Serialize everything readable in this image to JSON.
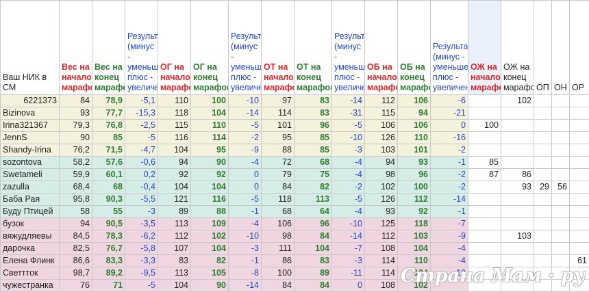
{
  "headers": [
    {
      "text": "Ваш НИК в СМ",
      "style": ""
    },
    {
      "text": "Вес на начало марафона",
      "style": "red"
    },
    {
      "text": "Вес на конец марафона",
      "style": "green"
    },
    {
      "text": "Результат (минус - уменьшение, плюс - увеличение)",
      "style": "blue"
    },
    {
      "text": "ОГ на начало марафона",
      "style": "red"
    },
    {
      "text": "ОГ на конец марафона",
      "style": "green"
    },
    {
      "text": "Результат (минус - уменьшение, плюс - увеличение)",
      "style": "blue"
    },
    {
      "text": "ОТ на начало марафона",
      "style": "red"
    },
    {
      "text": "ОТ на конец марафона",
      "style": "green"
    },
    {
      "text": "Результат (минус - уменьшение, плюс - увеличение)",
      "style": "blue"
    },
    {
      "text": "ОБ на начало марафона",
      "style": "red"
    },
    {
      "text": "ОБ на конец марафона",
      "style": "green"
    },
    {
      "text": "Результат (минус - уменьшение, плюс - увеличение)",
      "style": "blue"
    },
    {
      "text": "ОЖ на начало марафона",
      "style": "sel-red"
    },
    {
      "text": "ОЖ на конец марафона",
      "style": ""
    },
    {
      "text": "ОП",
      "style": ""
    },
    {
      "text": "ОН",
      "style": ""
    },
    {
      "text": "ОР",
      "style": ""
    }
  ],
  "rows": [
    {
      "group": "yellow",
      "cells": [
        "6221373",
        "84",
        "78,9",
        "-5,1",
        "110",
        "100",
        "-10",
        "97",
        "83",
        "-14",
        "112",
        "106",
        "-6",
        "",
        "102",
        "",
        "",
        ""
      ]
    },
    {
      "group": "yellow",
      "cells": [
        "Bizinova",
        "93",
        "77,7",
        "-15,3",
        "118",
        "104",
        "-14",
        "114",
        "83",
        "-31",
        "115",
        "94",
        "-21",
        "",
        "",
        "",
        "",
        ""
      ]
    },
    {
      "group": "yellow",
      "cells": [
        "Irina321367",
        "79,3",
        "76,8",
        "-2,5",
        "115",
        "110",
        "-5",
        "101",
        "96",
        "-5",
        "106",
        "106",
        "0",
        "100",
        "",
        "",
        "",
        ""
      ]
    },
    {
      "group": "yellow",
      "cells": [
        "JennS",
        "90",
        "85",
        "-5",
        "116",
        "114",
        "-2",
        "95",
        "85",
        "-10",
        "126",
        "110",
        "-16",
        "",
        "",
        "",
        "",
        ""
      ]
    },
    {
      "group": "yellow",
      "cells": [
        "Shandy-Irina",
        "76,2",
        "71,5",
        "-4,7",
        "104",
        "95",
        "-9",
        "88",
        "85",
        "-3",
        "103",
        "101",
        "-2",
        "",
        "",
        "",
        "",
        ""
      ]
    },
    {
      "group": "teal",
      "cells": [
        "sozontova",
        "58,2",
        "57,6",
        "-0,6",
        "94",
        "90",
        "-4",
        "72",
        "68",
        "-4",
        "94",
        "93",
        "-1",
        "85",
        "",
        "",
        "",
        ""
      ]
    },
    {
      "group": "teal",
      "cells": [
        "Swetameli",
        "59,9",
        "60,1",
        "0,2",
        "92",
        "92",
        "0",
        "79",
        "75",
        "-4",
        "98",
        "96",
        "-2",
        "87",
        "86",
        "",
        "",
        ""
      ]
    },
    {
      "group": "teal",
      "cells": [
        "zazulla",
        "68,4",
        "68",
        "-0,4",
        "104",
        "104",
        "0",
        "84",
        "82",
        "-2",
        "102",
        "100",
        "-2",
        "",
        "93",
        "29",
        "56",
        ""
      ]
    },
    {
      "group": "teal",
      "cells": [
        "Баба Рая",
        "95,8",
        "90,3",
        "-5,5",
        "121",
        "116",
        "-5",
        "118",
        "113",
        "-5",
        "126",
        "112",
        "-14",
        "",
        "",
        "",
        "",
        ""
      ]
    },
    {
      "group": "teal",
      "cells": [
        "Буду Птицей",
        "58",
        "55",
        "-3",
        "89",
        "88",
        "-1",
        "68",
        "64",
        "-4",
        "93",
        "92",
        "-1",
        "",
        "",
        "",
        "",
        ""
      ]
    },
    {
      "group": "pink",
      "cells": [
        "бузок",
        "94",
        "90,5",
        "-3,5",
        "113",
        "109",
        "-4",
        "106",
        "96",
        "-10",
        "125",
        "118",
        "-7",
        "",
        "",
        "",
        "",
        ""
      ]
    },
    {
      "group": "pink",
      "cells": [
        "вяжудляевы",
        "84,5",
        "78,3",
        "-6,2",
        "112",
        "102",
        "-10",
        "98",
        "84",
        "-14",
        "112",
        "103",
        "-9",
        "",
        "103",
        "",
        "",
        ""
      ]
    },
    {
      "group": "pink",
      "cells": [
        "дарочка",
        "82,5",
        "76,7",
        "-5,8",
        "107",
        "104",
        "-3",
        "111",
        "104",
        "-7",
        "108",
        "104",
        "-4",
        "",
        "",
        "",
        "",
        ""
      ]
    },
    {
      "group": "pink",
      "cells": [
        "Елена Флинк",
        "86,6",
        "83,3",
        "-3,3",
        "83",
        "82",
        "-1",
        "86",
        "83",
        "-3",
        "114",
        "110",
        "-4",
        "",
        "",
        "",
        "",
        "61"
      ]
    },
    {
      "group": "pink",
      "cells": [
        "Светтток",
        "98,7",
        "89,2",
        "-9,5",
        "113",
        "105",
        "-8",
        "100",
        "89",
        "-11",
        "114",
        "104",
        "-10",
        "",
        "",
        "",
        "",
        ""
      ]
    },
    {
      "group": "pink",
      "cells": [
        "чужестранка",
        "76",
        "71",
        "-5",
        "104",
        "90",
        "-14",
        "84",
        "84",
        "0",
        "108",
        "102",
        "",
        "",
        "",
        "",
        "",
        ""
      ]
    }
  ],
  "watermark": "Страна Мам · ру"
}
